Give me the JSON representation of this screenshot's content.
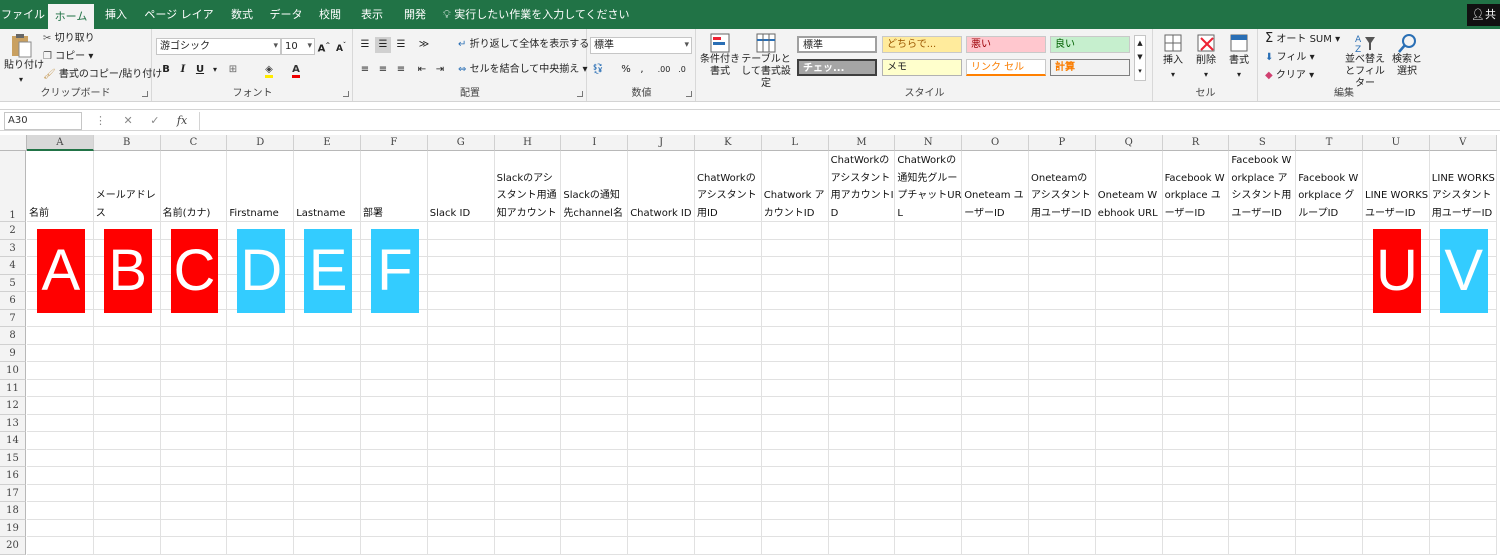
{
  "menu": {
    "tabs": [
      "ファイル",
      "ホーム",
      "挿入",
      "ページ レイアウト",
      "数式",
      "データ",
      "校閲",
      "表示",
      "開発"
    ],
    "tellme": "実行したい作業を入力してください",
    "share": "共有"
  },
  "ribbon": {
    "clipboard": {
      "paste": "貼り付け",
      "cut": "切り取り",
      "copy": "コピー",
      "format_painter": "書式のコピー/貼り付け",
      "label": "クリップボード"
    },
    "font": {
      "name": "游ゴシック",
      "size": "10",
      "label": "フォント"
    },
    "alignment": {
      "wrap": "折り返して全体を表示する",
      "merge": "セルを結合して中央揃え",
      "label": "配置"
    },
    "number": {
      "format": "標準",
      "label": "数値"
    },
    "styles": {
      "conditional": "条件付き書式",
      "table": "テーブルとして書式設定",
      "cells": [
        "標準",
        "どちらで...",
        "悪い",
        "良い",
        "チェッ...",
        "メモ",
        "リンク セル",
        "計算"
      ],
      "label": "スタイル"
    },
    "cells": {
      "insert": "挿入",
      "delete": "削除",
      "format": "書式",
      "label": "セル"
    },
    "editing": {
      "autosum": "オート SUM",
      "fill": "フィル",
      "clear": "クリア",
      "sort": "並べ替えとフィルター",
      "find": "検索と選択",
      "label": "編集"
    }
  },
  "formula_bar": {
    "name_box": "A30",
    "formula": ""
  },
  "sheet": {
    "columns": [
      "A",
      "B",
      "C",
      "D",
      "E",
      "F",
      "G",
      "H",
      "I",
      "J",
      "K",
      "L",
      "M",
      "N",
      "O",
      "P",
      "Q",
      "R",
      "S",
      "T",
      "U",
      "V"
    ],
    "rows": [
      "1",
      "2",
      "3",
      "4",
      "5",
      "6",
      "7",
      "8",
      "9",
      "10",
      "11",
      "12",
      "13",
      "14",
      "15",
      "16",
      "17",
      "18",
      "19",
      "20"
    ],
    "headers": [
      "名前",
      "メールアドレス",
      "名前(カナ)",
      "Firstname",
      "Lastname",
      "部署",
      "Slack ID",
      "Slackのアシスタント用通知アカウント",
      "Slackの通知先channel名",
      "Chatwork ID",
      "ChatWorkのアシスタント用ID",
      "Chatwork アカウントID",
      "ChatWorkのアシスタント用アカウントID",
      "ChatWorkの通知先グループチャットURL",
      "Oneteam ユーザーID",
      "Oneteamのアシスタント用ユーザーID",
      "Oneteam Webhook URL",
      "Facebook Workplace ユーザーID",
      "Facebook Workplace アシスタント用ユーザーID",
      "Facebook Workplace グループID",
      "LINE WORKS ユーザーID",
      "LINE WORKS アシスタント用ユーザーID"
    ],
    "badges": [
      {
        "letter": "A",
        "color": "#ff0000"
      },
      {
        "letter": "B",
        "color": "#ff0000"
      },
      {
        "letter": "C",
        "color": "#ff0000"
      },
      {
        "letter": "D",
        "color": "#33ccff"
      },
      {
        "letter": "E",
        "color": "#33ccff"
      },
      {
        "letter": "F",
        "color": "#33ccff"
      },
      {
        "letter": "U",
        "color": "#ff0000"
      },
      {
        "letter": "V",
        "color": "#33ccff"
      }
    ]
  },
  "colors": {
    "accent": "#217346",
    "red": "#ff0000",
    "blue": "#33ccff"
  }
}
